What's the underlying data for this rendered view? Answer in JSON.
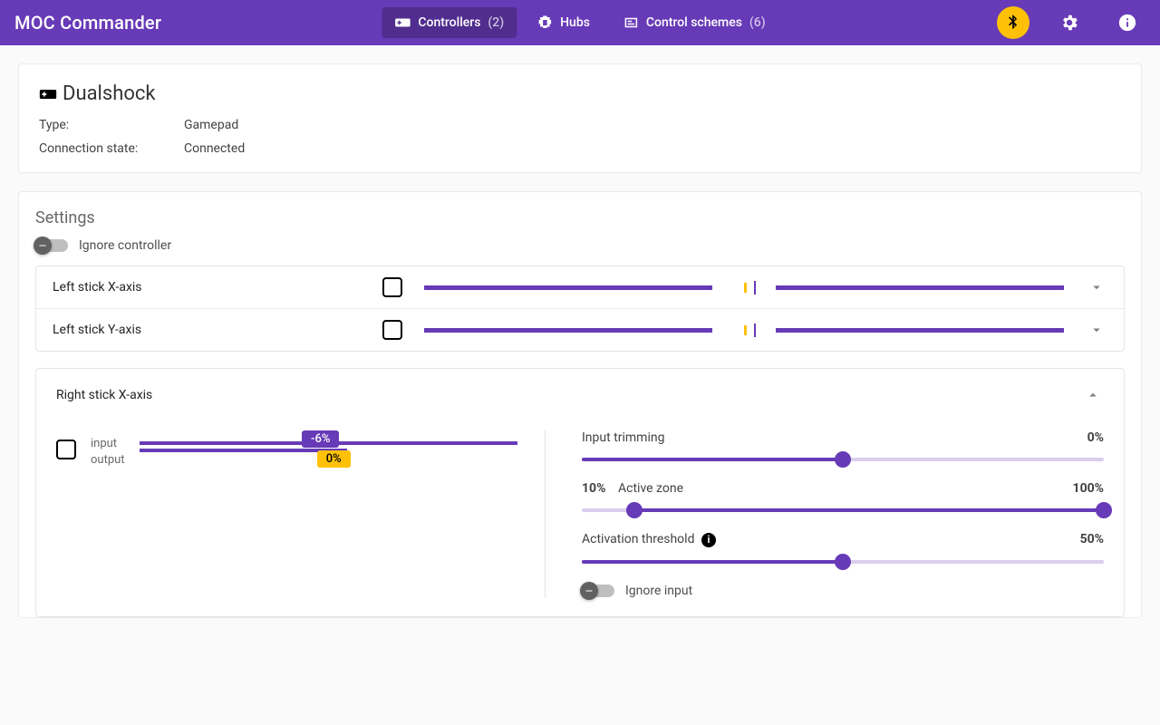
{
  "app": {
    "title": "MOC Commander"
  },
  "nav": {
    "controllers": {
      "label": "Controllers",
      "count": "(2)"
    },
    "hubs": {
      "label": "Hubs"
    },
    "schemes": {
      "label": "Control schemes",
      "count": "(6)"
    }
  },
  "device": {
    "name": "Dualshock",
    "type_label": "Type:",
    "type_value": "Gamepad",
    "conn_label": "Connection state:",
    "conn_value": "Connected"
  },
  "settings": {
    "title": "Settings",
    "ignore_controller": "Ignore controller",
    "axes": [
      {
        "label": "Left stick X-axis"
      },
      {
        "label": "Left stick Y-axis"
      }
    ],
    "expanded": {
      "label": "Right stick X-axis",
      "io": {
        "input": "input",
        "output": "output",
        "in_val": "-6%",
        "out_val": "0%"
      },
      "trimming": {
        "label": "Input trimming",
        "value": "0%"
      },
      "zone": {
        "label": "Active zone",
        "low": "10%",
        "high": "100%"
      },
      "threshold": {
        "label": "Activation threshold",
        "value": "50%"
      },
      "ignore_input": "Ignore input"
    }
  }
}
